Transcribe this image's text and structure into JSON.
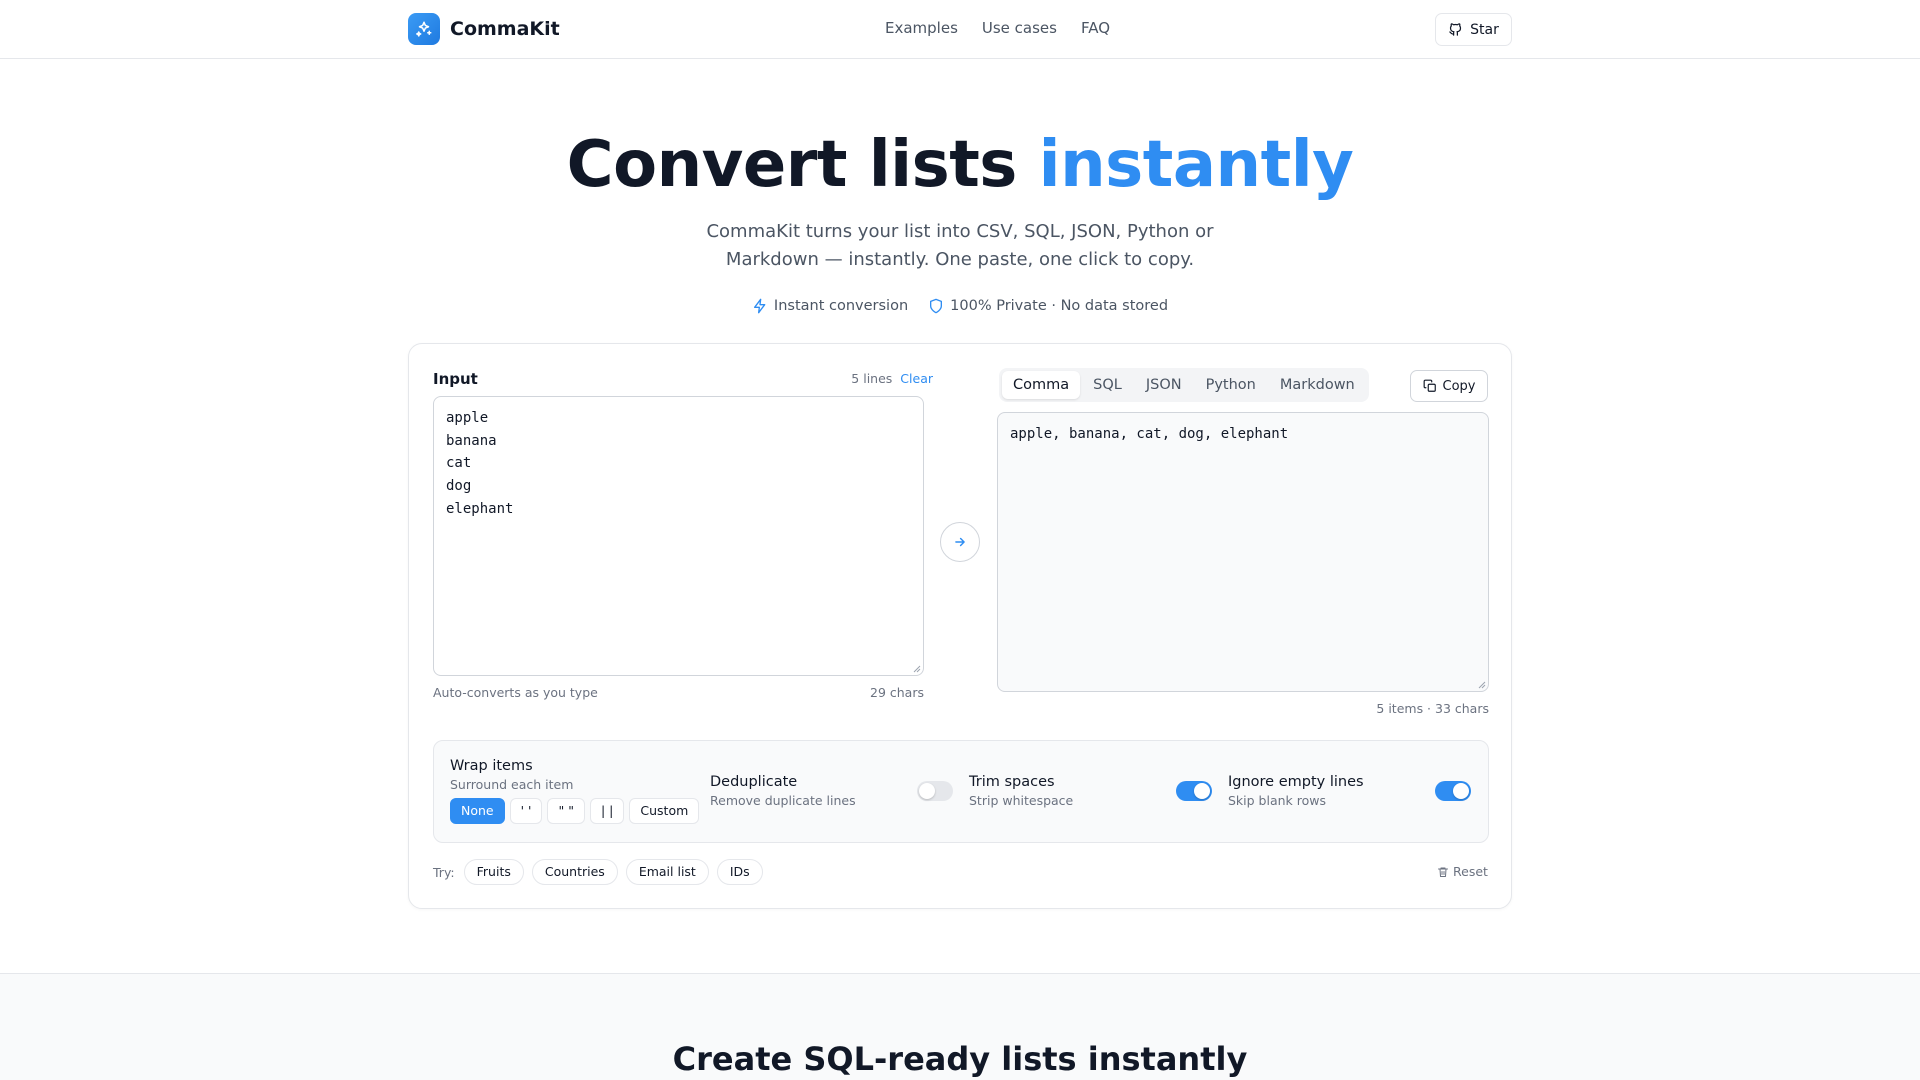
{
  "brand": {
    "name": "CommaKit",
    "logo_icon": "sparkle-icon"
  },
  "nav": {
    "items": [
      "Examples",
      "Use cases",
      "FAQ"
    ]
  },
  "header": {
    "star_label": "Star"
  },
  "hero": {
    "title_main": "Convert lists ",
    "title_accent": "instantly",
    "subtitle": "CommaKit turns your list into CSV, SQL, JSON, Python or Markdown — instantly. One paste, one click to copy.",
    "features": [
      "Instant conversion",
      "100% Private · No data stored"
    ]
  },
  "input": {
    "label": "Input",
    "line_count": "5 lines",
    "clear_label": "Clear",
    "value": "apple\nbanana\ncat\ndog\nelephant",
    "footer_left": "Auto-converts as you type",
    "footer_right": "29 chars"
  },
  "output": {
    "tabs": [
      "Comma",
      "SQL",
      "JSON",
      "Python",
      "Markdown"
    ],
    "active_tab": "Comma",
    "copy_label": "Copy",
    "value": "apple, banana, cat, dog, elephant",
    "footer": "5 items · 33 chars"
  },
  "options": {
    "wrap": {
      "title": "Wrap items",
      "subtitle": "Surround each item",
      "buttons": [
        "None",
        "' '",
        "\" \"",
        "| |",
        "Custom"
      ],
      "active": "None"
    },
    "deduplicate": {
      "title": "Deduplicate",
      "subtitle": "Remove duplicate lines",
      "on": false
    },
    "trim": {
      "title": "Trim spaces",
      "subtitle": "Strip whitespace",
      "on": true
    },
    "ignore_empty": {
      "title": "Ignore empty lines",
      "subtitle": "Skip blank rows",
      "on": true
    }
  },
  "try": {
    "label": "Try:",
    "chips": [
      "Fruits",
      "Countries",
      "Email list",
      "IDs"
    ],
    "reset_label": "Reset"
  },
  "section2": {
    "title": "Create SQL-ready lists instantly"
  },
  "colors": {
    "accent": "#2f8df2",
    "text": "#111827",
    "muted": "#6b7280",
    "border": "#e5e7eb"
  }
}
